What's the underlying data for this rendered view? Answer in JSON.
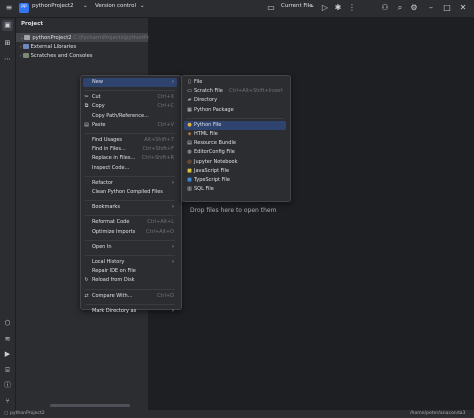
{
  "titlebar": {
    "project_badge": "PP",
    "project_name": "pythonProject2",
    "vcs": "Version control",
    "run_config": "Current File"
  },
  "project_panel": {
    "header": "Project",
    "tree": [
      {
        "label": "pythonProject2",
        "path": "C:\\PycharmProjects\\pythonPro"
      },
      {
        "label": "External Libraries",
        "path": ""
      },
      {
        "label": "Scratches and Consoles",
        "path": ""
      }
    ]
  },
  "editor": {
    "drop_hint": "Drop files here to open them"
  },
  "context_menu": [
    {
      "label": "New",
      "shortcut": "",
      "submenu": true,
      "icon": "",
      "hl": true
    },
    {
      "sep": true
    },
    {
      "label": "Cut",
      "shortcut": "Ctrl+X",
      "icon": "scissors-icon"
    },
    {
      "label": "Copy",
      "shortcut": "Ctrl+C",
      "icon": "copy-icon"
    },
    {
      "label": "Copy Path/Reference...",
      "shortcut": ""
    },
    {
      "label": "Paste",
      "shortcut": "Ctrl+V",
      "icon": "paste-icon"
    },
    {
      "sep": true
    },
    {
      "label": "Find Usages",
      "shortcut": "Alt+Shift+7"
    },
    {
      "label": "Find in Files...",
      "shortcut": "Ctrl+Shift+F"
    },
    {
      "label": "Replace in Files...",
      "shortcut": "Ctrl+Shift+R"
    },
    {
      "label": "Inspect Code...",
      "shortcut": ""
    },
    {
      "sep": true
    },
    {
      "label": "Refactor",
      "shortcut": "",
      "submenu": true
    },
    {
      "label": "Clean Python Compiled Files",
      "shortcut": ""
    },
    {
      "sep": true
    },
    {
      "label": "Bookmarks",
      "shortcut": "",
      "submenu": true
    },
    {
      "sep": true
    },
    {
      "label": "Reformat Code",
      "shortcut": "Ctrl+Alt+L"
    },
    {
      "label": "Optimize Imports",
      "shortcut": "Ctrl+Alt+O"
    },
    {
      "sep": true
    },
    {
      "label": "Open In",
      "shortcut": "",
      "submenu": true
    },
    {
      "sep": true
    },
    {
      "label": "Local History",
      "shortcut": "",
      "submenu": true
    },
    {
      "label": "Repair IDE on File",
      "shortcut": ""
    },
    {
      "label": "Reload from Disk",
      "shortcut": "",
      "icon": "reload-icon"
    },
    {
      "sep": true
    },
    {
      "label": "Compare With...",
      "shortcut": "Ctrl+D",
      "icon": "compare-icon"
    },
    {
      "sep": true
    },
    {
      "label": "Mark Directory as",
      "shortcut": "",
      "submenu": true
    }
  ],
  "new_submenu": [
    {
      "label": "File",
      "shortcut": "",
      "icon": "file-icon"
    },
    {
      "label": "Scratch File",
      "shortcut": "Ctrl+Alt+Shift+Insert",
      "icon": "scratch-file-icon"
    },
    {
      "label": "Directory",
      "shortcut": "",
      "icon": "folder-icon"
    },
    {
      "label": "Python Package",
      "shortcut": "",
      "icon": "package-icon"
    },
    {
      "sep": true
    },
    {
      "label": "Python File",
      "shortcut": "",
      "icon": "python-icon",
      "hl": true
    },
    {
      "label": "HTML File",
      "shortcut": "",
      "icon": "html-icon"
    },
    {
      "label": "Resource Bundle",
      "shortcut": "",
      "icon": "resource-bundle-icon"
    },
    {
      "label": "EditorConfig File",
      "shortcut": "",
      "icon": "editorconfig-icon"
    },
    {
      "label": "Jupyter Notebook",
      "shortcut": "",
      "icon": "jupyter-icon"
    },
    {
      "label": "JavaScript File",
      "shortcut": "",
      "icon": "javascript-icon"
    },
    {
      "label": "TypeScript File",
      "shortcut": "",
      "icon": "typescript-icon"
    },
    {
      "label": "SQL File",
      "shortcut": "",
      "icon": "sql-icon"
    }
  ],
  "statusbar": {
    "breadcrumb": "pythonProject2",
    "interpreter": "/home/peter/anaconda3"
  },
  "colors": {
    "accent": "#2e436e",
    "badge": "#3574f0"
  }
}
